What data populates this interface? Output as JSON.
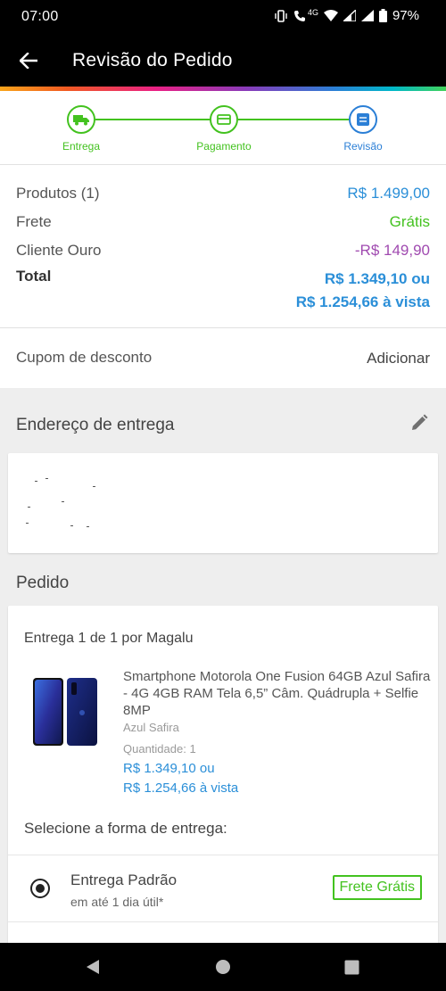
{
  "status_bar": {
    "time": "07:00",
    "battery": "97%",
    "network": "4G"
  },
  "app_bar": {
    "title": "Revisão do Pedido"
  },
  "stepper": {
    "steps": [
      {
        "label": "Entrega",
        "icon": "truck-icon",
        "state": "done"
      },
      {
        "label": "Pagamento",
        "icon": "card-icon",
        "state": "done"
      },
      {
        "label": "Revisão",
        "icon": "review-icon",
        "state": "active"
      }
    ]
  },
  "summary": {
    "products_label": "Produtos (1)",
    "products_value": "R$ 1.499,00",
    "shipping_label": "Frete",
    "shipping_value": "Grátis",
    "client_label": "Cliente Ouro",
    "client_value": "-R$ 149,90",
    "total_label": "Total",
    "total_line1": "R$ 1.349,10 ou",
    "total_line2": "R$ 1.254,66 à vista"
  },
  "coupon": {
    "label": "Cupom de desconto",
    "action": "Adicionar"
  },
  "address": {
    "title": "Endereço de entrega"
  },
  "order": {
    "title": "Pedido",
    "delivery_header": "Entrega 1 de 1 por Magalu",
    "product": {
      "name": "Smartphone Motorola One Fusion 64GB Azul Safira - 4G 4GB RAM Tela 6,5” Câm. Quádrupla + Selfie 8MP",
      "color": "Azul Safira",
      "quantity": "Quantidade:  1",
      "price_line1": "R$ 1.349,10 ou",
      "price_line2": "R$ 1.254,66 à vista"
    },
    "select_shipping_label": "Selecione a forma de entrega:",
    "shipping_option": {
      "name": "Entrega Padrão",
      "time": "em até 1 dia útil*",
      "badge": "Frete Grátis"
    }
  },
  "colors": {
    "accent_blue": "#2b8fd8",
    "green": "#43c21f",
    "purple": "#a04ab0"
  }
}
